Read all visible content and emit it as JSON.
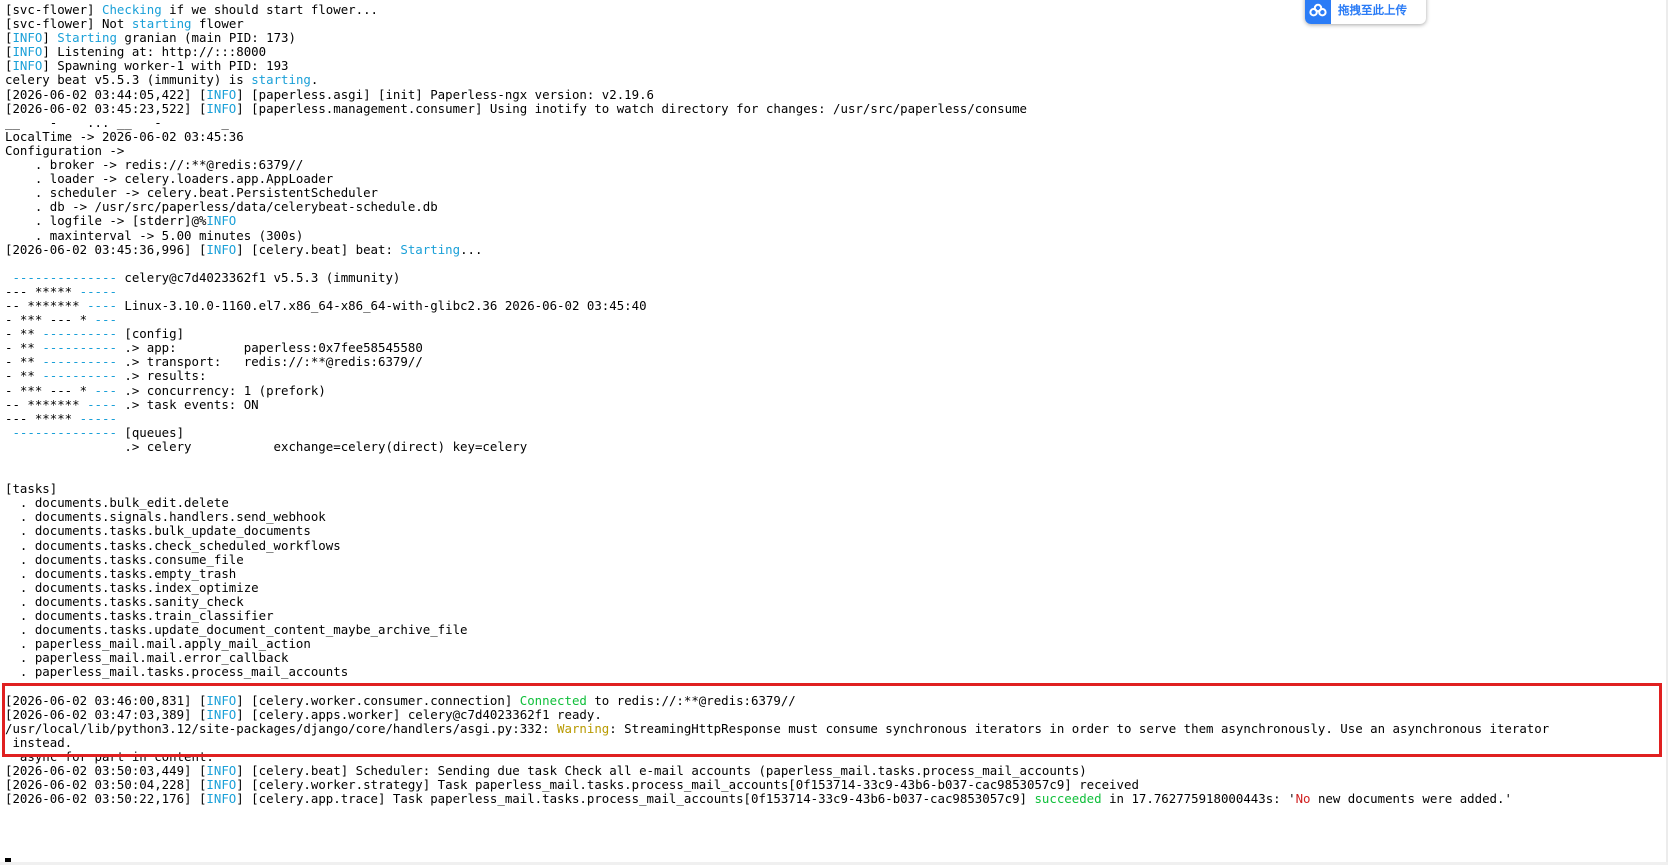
{
  "colors": {
    "c": "#1aa0d8",
    "g": "#0fbf3a",
    "y": "#b89a00",
    "r": "#d01f1f",
    "highlight_border": "#e02020",
    "upload_accent": "#2b7cf6"
  },
  "upload_widget": {
    "label": "拖拽至此上传",
    "icon": "baidu-cloud-icon"
  },
  "lines": [
    [
      [
        "k",
        "[svc-flower] "
      ],
      [
        "c",
        "Checking"
      ],
      [
        "k",
        " if we should start flower..."
      ]
    ],
    [
      [
        "k",
        "[svc-flower] Not "
      ],
      [
        "c",
        "starting"
      ],
      [
        "k",
        " flower"
      ]
    ],
    [
      [
        "k",
        "["
      ],
      [
        "c",
        "INFO"
      ],
      [
        "k",
        "] "
      ],
      [
        "c",
        "Starting"
      ],
      [
        "k",
        " granian (main PID: 173)"
      ]
    ],
    [
      [
        "k",
        "["
      ],
      [
        "c",
        "INFO"
      ],
      [
        "k",
        "] Listening at: http://:::8000"
      ]
    ],
    [
      [
        "k",
        "["
      ],
      [
        "c",
        "INFO"
      ],
      [
        "k",
        "] Spawning worker-1 with PID: 193"
      ]
    ],
    [
      [
        "k",
        "celery beat v5.5.3 (immunity) is "
      ],
      [
        "c",
        "starting"
      ],
      [
        "k",
        "."
      ]
    ],
    [
      [
        "k",
        "[2026-06-02 03:44:05,422] ["
      ],
      [
        "c",
        "INFO"
      ],
      [
        "k",
        "] [paperless.asgi] [init] Paperless-ngx version: v2.19.6"
      ]
    ],
    [
      [
        "k",
        "[2026-06-02 03:45:23,522] ["
      ],
      [
        "c",
        "INFO"
      ],
      [
        "k",
        "] [paperless.management.consumer] Using inotify to watch directory for changes: /usr/src/paperless/consume"
      ]
    ],
    [
      [
        "k",
        "__    -    ... __   -        _"
      ]
    ],
    [
      [
        "k",
        "LocalTime -> 2026-06-02 03:45:36"
      ]
    ],
    [
      [
        "k",
        "Configuration ->"
      ]
    ],
    [
      [
        "k",
        "    . broker -> redis://:**@redis:6379//"
      ]
    ],
    [
      [
        "k",
        "    . loader -> celery.loaders.app.AppLoader"
      ]
    ],
    [
      [
        "k",
        "    . scheduler -> celery.beat.PersistentScheduler"
      ]
    ],
    [
      [
        "k",
        "    . db -> /usr/src/paperless/data/celerybeat-schedule.db"
      ]
    ],
    [
      [
        "k",
        "    . logfile -> [stderr]@%"
      ],
      [
        "c",
        "INFO"
      ]
    ],
    [
      [
        "k",
        "    . maxinterval -> 5.00 minutes (300s)"
      ]
    ],
    [
      [
        "k",
        "[2026-06-02 03:45:36,996] ["
      ],
      [
        "c",
        "INFO"
      ],
      [
        "k",
        "] [celery.beat] beat: "
      ],
      [
        "c",
        "Starting"
      ],
      [
        "k",
        "..."
      ]
    ],
    [
      [
        "k",
        ""
      ]
    ],
    [
      [
        "k",
        " "
      ],
      [
        "c",
        "--------------"
      ],
      [
        "k",
        " celery@c7d4023362f1 v5.5.3 (immunity)"
      ]
    ],
    [
      [
        "k",
        "--- ***** "
      ],
      [
        "c",
        "-----"
      ]
    ],
    [
      [
        "k",
        "-- ******* "
      ],
      [
        "c",
        "----"
      ],
      [
        "k",
        " Linux-3.10.0-1160.el7.x86_64-x86_64-with-glibc2.36 2026-06-02 03:45:40"
      ]
    ],
    [
      [
        "k",
        "- *** --- * "
      ],
      [
        "c",
        "---"
      ]
    ],
    [
      [
        "k",
        "- ** "
      ],
      [
        "c",
        "----------"
      ],
      [
        "k",
        " [config]"
      ]
    ],
    [
      [
        "k",
        "- ** "
      ],
      [
        "c",
        "----------"
      ],
      [
        "k",
        " .> app:         paperless:0x7fee58545580"
      ]
    ],
    [
      [
        "k",
        "- ** "
      ],
      [
        "c",
        "----------"
      ],
      [
        "k",
        " .> transport:   redis://:**@redis:6379//"
      ]
    ],
    [
      [
        "k",
        "- ** "
      ],
      [
        "c",
        "----------"
      ],
      [
        "k",
        " .> results:"
      ]
    ],
    [
      [
        "k",
        "- *** --- * "
      ],
      [
        "c",
        "---"
      ],
      [
        "k",
        " .> concurrency: 1 (prefork)"
      ]
    ],
    [
      [
        "k",
        "-- ******* "
      ],
      [
        "c",
        "----"
      ],
      [
        "k",
        " .> task events: ON"
      ]
    ],
    [
      [
        "k",
        "--- ***** "
      ],
      [
        "c",
        "-----"
      ]
    ],
    [
      [
        "k",
        " "
      ],
      [
        "c",
        "--------------"
      ],
      [
        "k",
        " [queues]"
      ]
    ],
    [
      [
        "k",
        "                .> celery           exchange=celery(direct) key=celery"
      ]
    ],
    [
      [
        "k",
        ""
      ]
    ],
    [
      [
        "k",
        ""
      ]
    ],
    [
      [
        "k",
        "[tasks]"
      ]
    ],
    [
      [
        "k",
        "  . documents.bulk_edit.delete"
      ]
    ],
    [
      [
        "k",
        "  . documents.signals.handlers.send_webhook"
      ]
    ],
    [
      [
        "k",
        "  . documents.tasks.bulk_update_documents"
      ]
    ],
    [
      [
        "k",
        "  . documents.tasks.check_scheduled_workflows"
      ]
    ],
    [
      [
        "k",
        "  . documents.tasks.consume_file"
      ]
    ],
    [
      [
        "k",
        "  . documents.tasks.empty_trash"
      ]
    ],
    [
      [
        "k",
        "  . documents.tasks.index_optimize"
      ]
    ],
    [
      [
        "k",
        "  . documents.tasks.sanity_check"
      ]
    ],
    [
      [
        "k",
        "  . documents.tasks.train_classifier"
      ]
    ],
    [
      [
        "k",
        "  . documents.tasks.update_document_content_maybe_archive_file"
      ]
    ],
    [
      [
        "k",
        "  . paperless_mail.mail.apply_mail_action"
      ]
    ],
    [
      [
        "k",
        "  . paperless_mail.mail.error_callback"
      ]
    ],
    [
      [
        "k",
        "  . paperless_mail.tasks.process_mail_accounts"
      ]
    ],
    [
      [
        "k",
        ""
      ]
    ],
    [
      [
        "k",
        "[2026-06-02 03:46:00,831] ["
      ],
      [
        "c",
        "INFO"
      ],
      [
        "k",
        "] [celery.worker.consumer.connection] "
      ],
      [
        "g",
        "Connected"
      ],
      [
        "k",
        " to redis://:**@redis:6379//"
      ]
    ],
    [
      [
        "k",
        "[2026-06-02 03:47:03,389] ["
      ],
      [
        "c",
        "INFO"
      ],
      [
        "k",
        "] [celery.apps.worker] celery@c7d4023362f1 ready."
      ]
    ],
    [
      [
        "k",
        "/usr/local/lib/python3.12/site-packages/django/core/handlers/asgi.py:332: "
      ],
      [
        "y",
        "Warning"
      ],
      [
        "k",
        ": StreamingHttpResponse must consume synchronous iterators in order to serve them asynchronously. Use an asynchronous iterator"
      ]
    ],
    [
      [
        "k",
        " instead."
      ]
    ],
    [
      [
        "k",
        "  async for part in content:"
      ]
    ],
    [
      [
        "k",
        "[2026-06-02 03:50:03,449] ["
      ],
      [
        "c",
        "INFO"
      ],
      [
        "k",
        "] [celery.beat] Scheduler: Sending due task Check all e-mail accounts (paperless_mail.tasks.process_mail_accounts)"
      ]
    ],
    [
      [
        "k",
        "[2026-06-02 03:50:04,228] ["
      ],
      [
        "c",
        "INFO"
      ],
      [
        "k",
        "] [celery.worker.strategy] Task paperless_mail.tasks.process_mail_accounts[0f153714-33c9-43b6-b037-cac9853057c9] received"
      ]
    ],
    [
      [
        "k",
        "[2026-06-02 03:50:22,176] ["
      ],
      [
        "c",
        "INFO"
      ],
      [
        "k",
        "] [celery.app.trace] Task paperless_mail.tasks.process_mail_accounts[0f153714-33c9-43b6-b037-cac9853057c9] "
      ],
      [
        "g",
        "succeeded"
      ],
      [
        "k",
        " in 17.762775918000443s: '"
      ],
      [
        "r",
        "No"
      ],
      [
        "k",
        " new documents were added.'"
      ]
    ]
  ]
}
